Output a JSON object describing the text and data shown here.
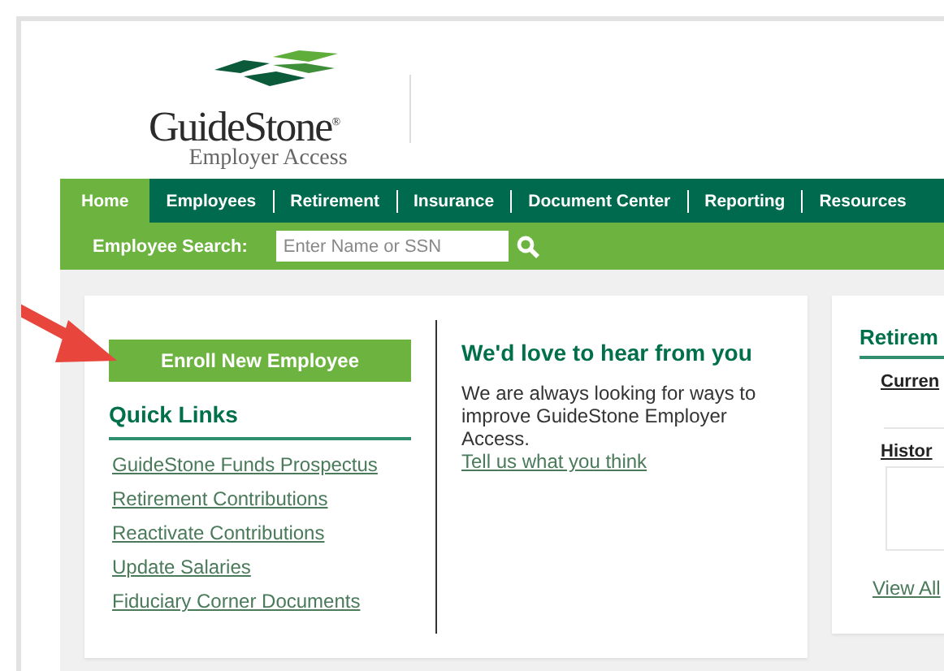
{
  "logo": {
    "name": "GuideStone",
    "mark": "®",
    "tagline": "Employer Access"
  },
  "nav": {
    "tabs": [
      {
        "label": "Home",
        "selected": true
      },
      {
        "label": "Employees",
        "selected": false
      },
      {
        "label": "Retirement",
        "selected": false
      },
      {
        "label": "Insurance",
        "selected": false
      },
      {
        "label": "Document Center",
        "selected": false
      },
      {
        "label": "Reporting",
        "selected": false
      },
      {
        "label": "Resources",
        "selected": false
      }
    ]
  },
  "search": {
    "label": "Employee Search:",
    "placeholder": "Enter Name or SSN"
  },
  "enroll_button": "Enroll New Employee",
  "quick_links": {
    "title": "Quick Links",
    "links": [
      "GuideStone Funds Prospectus",
      "Retirement Contributions",
      "Reactivate Contributions",
      "Update Salaries",
      "Fiduciary Corner Documents"
    ]
  },
  "feedback": {
    "title": "We'd love to hear from you",
    "body": "We are always looking for ways to improve GuideStone Employer Access.",
    "link": "Tell us what you think"
  },
  "retirement_card": {
    "title": "Retirem",
    "sections": [
      {
        "label": "Curren",
        "kind": "text"
      },
      {
        "label": "Histor",
        "kind": "box"
      }
    ],
    "link": "View All"
  }
}
